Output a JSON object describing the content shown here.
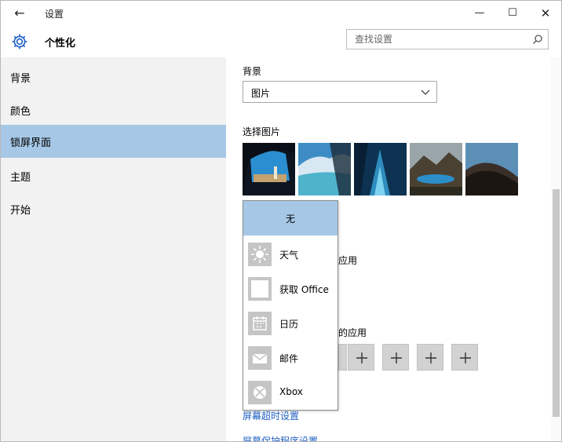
{
  "titlebar": {
    "title": "设置",
    "minimize": "—",
    "maximize": "☐",
    "close": "✕"
  },
  "header": {
    "title": "个性化",
    "search_placeholder": "查找设置"
  },
  "sidebar": {
    "items": [
      {
        "label": "背景",
        "active": false
      },
      {
        "label": "颜色",
        "active": false
      },
      {
        "label": "锁屏界面",
        "active": true
      },
      {
        "label": "主题",
        "active": false
      },
      {
        "label": "开始",
        "active": false
      }
    ]
  },
  "content": {
    "background_label": "背景",
    "background_value": "图片",
    "choose_picture_label": "选择图片",
    "partial_1": "应用",
    "partial_2": "的应用",
    "link_1": "屏幕超时设置",
    "link_2": "屏幕保护程序设置"
  },
  "flyout": {
    "items": [
      {
        "label": "无",
        "icon": "none",
        "selected": true
      },
      {
        "label": "天气",
        "icon": "weather-sun-icon"
      },
      {
        "label": "获取 Office",
        "icon": "office-blank-icon"
      },
      {
        "label": "日历",
        "icon": "calendar-icon"
      },
      {
        "label": "邮件",
        "icon": "mail-icon"
      },
      {
        "label": "Xbox",
        "icon": "xbox-icon"
      }
    ]
  },
  "colors": {
    "accent": "#a6c8e6",
    "sidebar_bg": "#f2f2f2",
    "link": "#1d5fc5",
    "tile": "#d2d2d2"
  }
}
